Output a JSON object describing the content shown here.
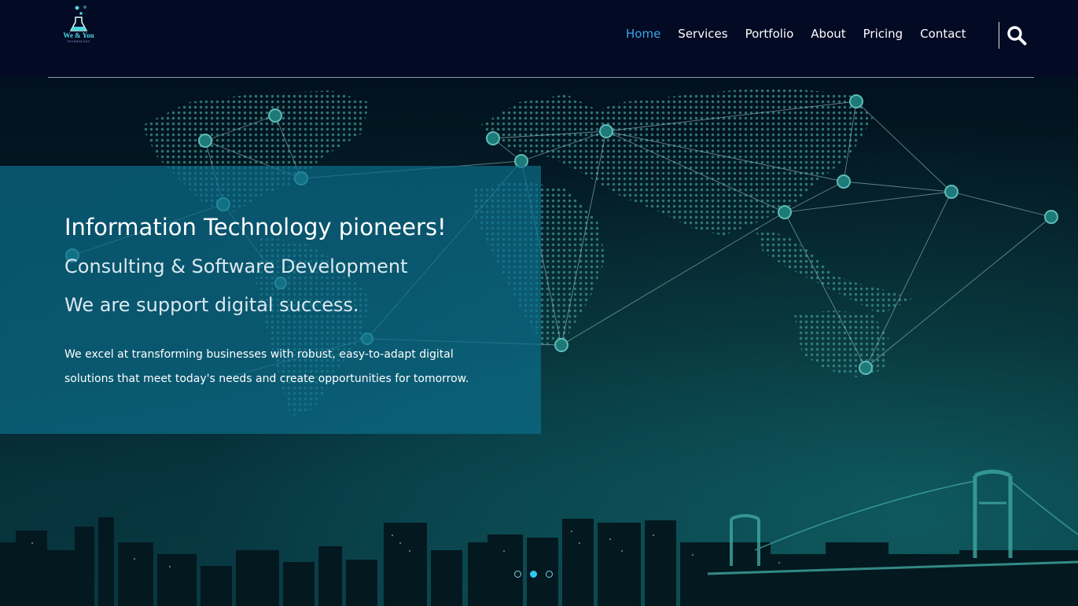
{
  "brand": {
    "logo_name": "We & You",
    "logo_tagline": "TECHNOLOGY"
  },
  "nav": {
    "items": [
      {
        "label": "Home",
        "active": true
      },
      {
        "label": "Services",
        "active": false
      },
      {
        "label": "Portfolio",
        "active": false
      },
      {
        "label": "About",
        "active": false
      },
      {
        "label": "Pricing",
        "active": false
      },
      {
        "label": "Contact",
        "active": false
      }
    ],
    "search_icon": "search-icon",
    "active_color": "#3aa7e6"
  },
  "hero": {
    "title": "Information Technology pioneers!",
    "subtitle": "Consulting & Software Development",
    "tagline": "We are support digital success.",
    "description": "We excel at transforming businesses with robust, easy-to-adapt digital solutions that meet today's needs and create opportunities for tomorrow."
  },
  "slider": {
    "slide_count": 3,
    "active_index": 1
  },
  "colors": {
    "header_bg": "#020a24",
    "panel": "#0c6e8c",
    "accent": "#2ec7f2"
  }
}
